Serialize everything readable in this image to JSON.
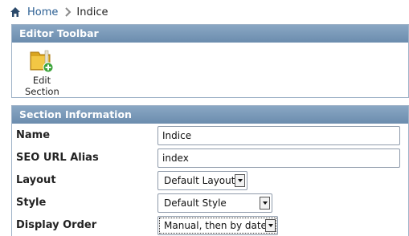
{
  "breadcrumb": {
    "home_label": "Home",
    "current_label": "Indice"
  },
  "toolbar": {
    "title": "Editor Toolbar",
    "edit_section_label": "Edit Section",
    "edit_section_line1": "Edit",
    "edit_section_line2": "Section",
    "edit_section_icon": "folder-add-icon"
  },
  "section_info": {
    "title": "Section Information",
    "fields": {
      "name": {
        "label": "Name",
        "value": "Indice"
      },
      "seo_url_alias": {
        "label": "SEO URL Alias",
        "value": "index"
      },
      "layout": {
        "label": "Layout",
        "value": "Default Layout"
      },
      "style": {
        "label": "Style",
        "value": "Default Style"
      },
      "display_order": {
        "label": "Display Order",
        "value": "Manual, then by date"
      }
    }
  },
  "colors": {
    "link": "#2b5f93",
    "header_bar": "#7896b6",
    "panel_border": "#9fb3c8"
  }
}
